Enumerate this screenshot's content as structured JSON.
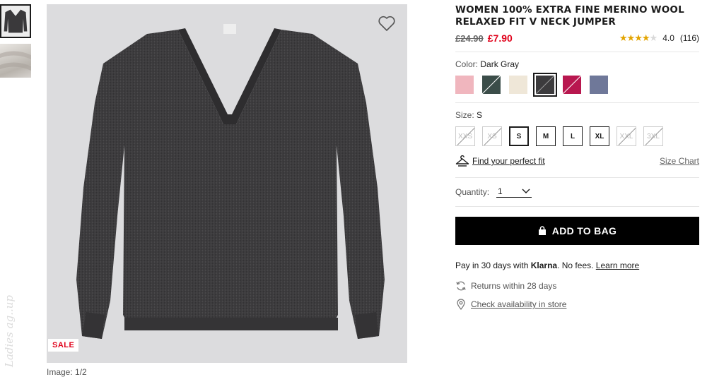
{
  "product": {
    "title": "WOMEN 100% EXTRA FINE MERINO WOOL RELAXED FIT V NECK JUMPER",
    "old_price": "£24.90",
    "new_price": "£7.90",
    "rating_value": "4.0",
    "rating_count": "(116)",
    "rating_stars": 4,
    "price_color": "#e0001a"
  },
  "gallery": {
    "sale_badge": "SALE",
    "image_counter": "Image: 1/2",
    "watermark": "Ladies ag..up",
    "wishlist_icon": "heart-outline-icon"
  },
  "color": {
    "label": "Color:",
    "selected": "Dark Gray",
    "swatches": [
      {
        "name": "Pink",
        "hex": "#f0b6be",
        "selected": false
      },
      {
        "name": "Dark Green",
        "hex": "#3b4d49",
        "selected": false
      },
      {
        "name": "Natural",
        "hex": "#efe7d8",
        "selected": false
      },
      {
        "name": "Dark Gray",
        "hex": "#3c3b3d",
        "selected": true
      },
      {
        "name": "Wine",
        "hex": "#b8174f",
        "selected": false
      },
      {
        "name": "Blue",
        "hex": "#6f7899",
        "selected": false
      }
    ]
  },
  "size": {
    "label": "Size:",
    "selected": "S",
    "options": [
      {
        "label": "XXS",
        "state": "oos"
      },
      {
        "label": "XS",
        "state": "oos"
      },
      {
        "label": "S",
        "state": "sel"
      },
      {
        "label": "M",
        "state": "avail"
      },
      {
        "label": "L",
        "state": "avail"
      },
      {
        "label": "XL",
        "state": "avail"
      },
      {
        "label": "XXL",
        "state": "oos"
      },
      {
        "label": "3XL",
        "state": "oos"
      }
    ],
    "fit_link": "Find your perfect fit",
    "size_chart": "Size Chart"
  },
  "quantity": {
    "label": "Quantity:",
    "value": "1"
  },
  "cart": {
    "add_label": "ADD TO BAG"
  },
  "klarna": {
    "prefix": "Pay in 30 days with",
    "brand": "Klarna",
    "suffix": ". No fees.",
    "link": "Learn more"
  },
  "returns": {
    "text": "Returns within 28 days"
  },
  "store": {
    "link": "Check availability in store"
  }
}
